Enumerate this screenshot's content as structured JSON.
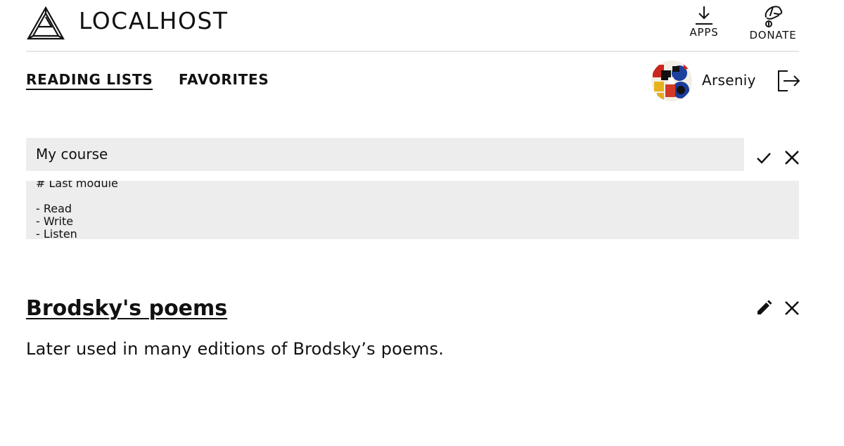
{
  "header": {
    "logo_icon": "impossible-triangle-logo",
    "site_title": "LOCALHOST",
    "apps_label": "APPS",
    "donate_label": "DONATE"
  },
  "nav": {
    "tabs": [
      {
        "label": "READING LISTS",
        "active": true
      },
      {
        "label": "FAVORITES",
        "active": false
      }
    ]
  },
  "user": {
    "name": "Arseniy",
    "avatar_icon": "abstract-collage-avatar",
    "logout_icon": "logout-icon"
  },
  "edit_form": {
    "title_value": "My course",
    "description_value": "# Last module\n\n- Read\n- Write\n- Listen",
    "confirm_icon": "check-icon",
    "cancel_icon": "close-icon"
  },
  "reading_lists": [
    {
      "title": "Brodsky's poems",
      "description": "Later used in many editions of Brodsky’s poems.",
      "edit_icon": "pencil-icon",
      "delete_icon": "close-icon"
    }
  ]
}
